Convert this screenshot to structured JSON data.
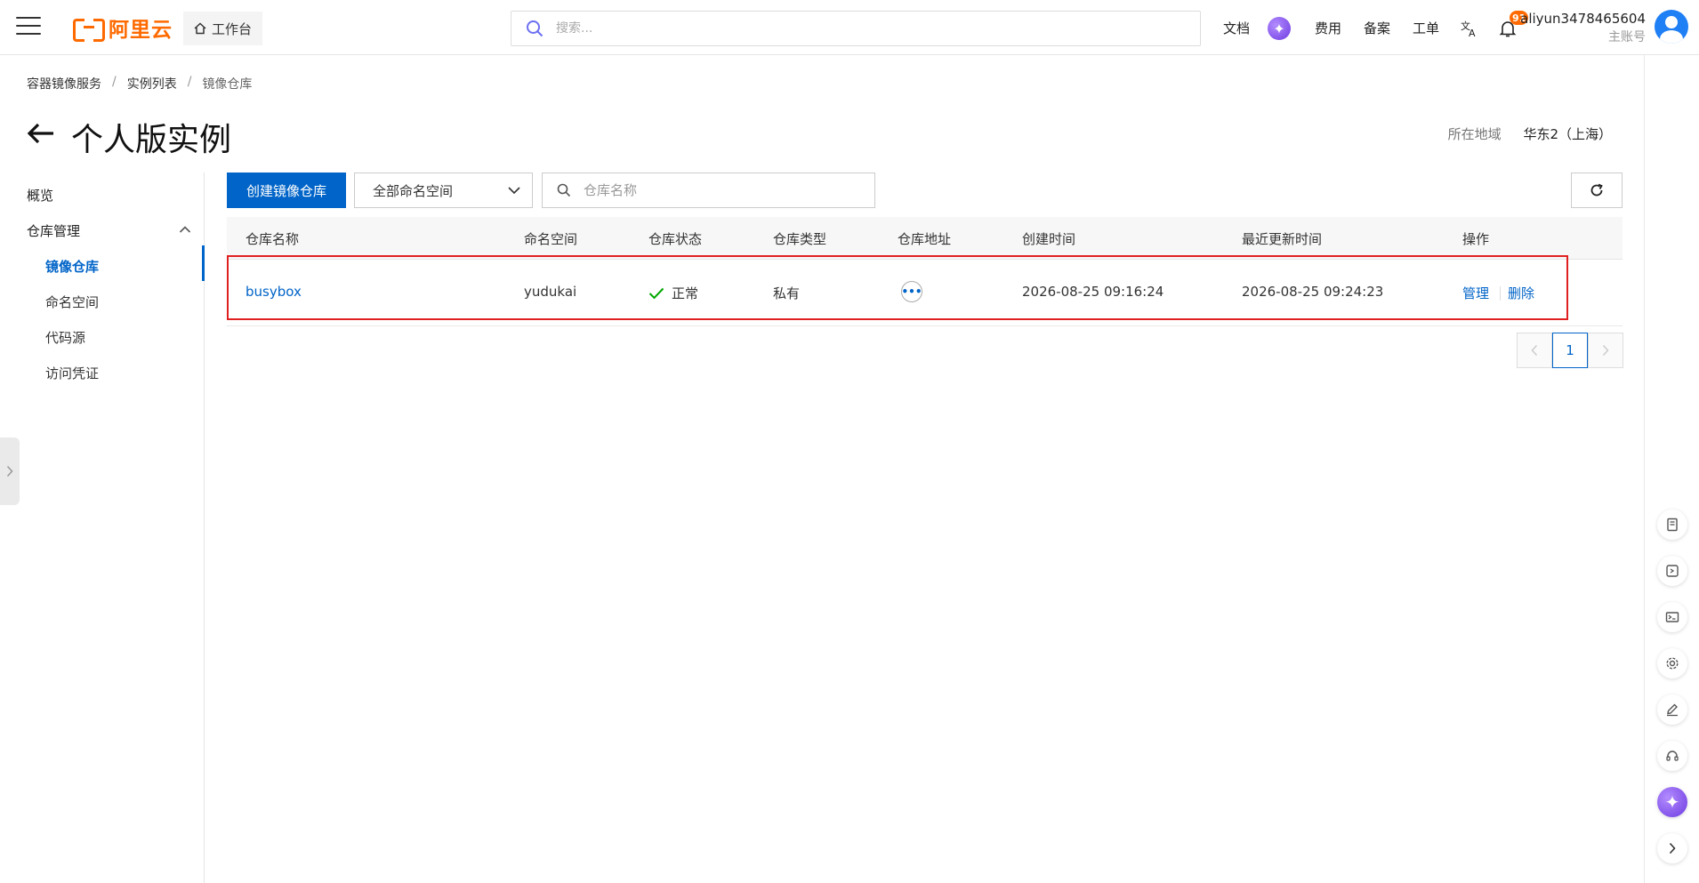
{
  "topbar": {
    "logo_text": "阿里云",
    "workbench_label": "工作台",
    "search_placeholder": "搜索...",
    "links": [
      "文档",
      "费用",
      "备案",
      "工单"
    ],
    "notification_count": "91",
    "username": "aliyun3478465604",
    "account_role": "主账号"
  },
  "breadcrumb": [
    "容器镜像服务",
    "实例列表",
    "镜像仓库"
  ],
  "page": {
    "title": "个人版实例",
    "region_label": "所在地域",
    "region_value": "华东2（上海）"
  },
  "sidebar": {
    "overview": "概览",
    "repo_management": "仓库管理",
    "sub_items": [
      "镜像仓库",
      "命名空间",
      "代码源",
      "访问凭证"
    ],
    "active_index": 0
  },
  "toolbar": {
    "create_button": "创建镜像仓库",
    "namespace_select": "全部命名空间",
    "repo_search_placeholder": "仓库名称"
  },
  "table": {
    "columns": [
      "仓库名称",
      "命名空间",
      "仓库状态",
      "仓库类型",
      "仓库地址",
      "创建时间",
      "最近更新时间",
      "操作"
    ],
    "rows": [
      {
        "name": "busybox",
        "namespace": "yudukai",
        "status": "正常",
        "type": "私有",
        "created": "2026-08-25 09:16:24",
        "updated": "2026-08-25 09:24:23",
        "action_manage": "管理",
        "action_delete": "删除"
      }
    ]
  },
  "pagination": {
    "current_page": "1"
  },
  "colors": {
    "brand": "#ff6a00",
    "primary": "#0064c8",
    "success": "#00a700",
    "highlight": "#e02020"
  }
}
